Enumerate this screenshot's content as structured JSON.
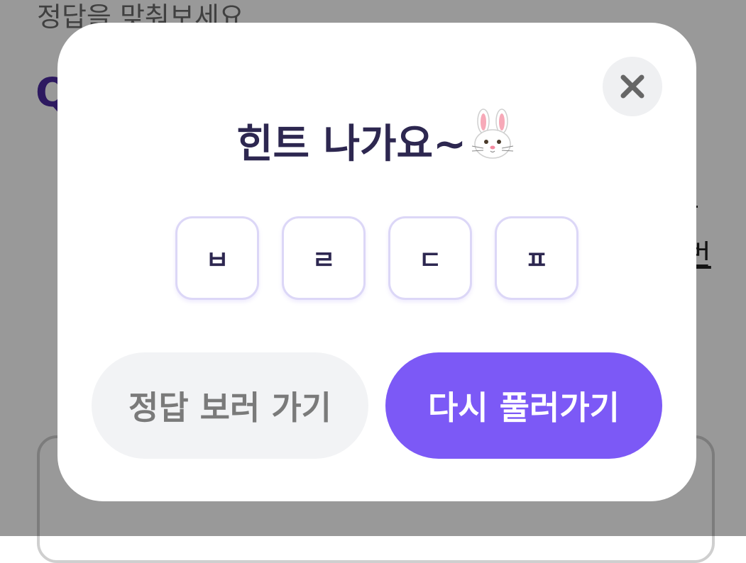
{
  "background": {
    "instruction": "정답을 맞춰보세요",
    "question_prefix": "Q",
    "right_text": "번"
  },
  "modal": {
    "title": "힌트 나가요~",
    "title_emoji": "rabbit-face",
    "close_icon": "close-icon",
    "hints": [
      "ㅂ",
      "ㄹ",
      "ㄷ",
      "ㅍ"
    ],
    "secondary_button": "정답 보러 가기",
    "primary_button": "다시 풀러가기"
  },
  "colors": {
    "accent": "#7c59f6",
    "title": "#2d2750",
    "secondary_bg": "#f2f3f5",
    "secondary_text": "#7a7a7a",
    "tile_border": "#dcd7f7",
    "overlay": "rgba(0,0,0,0.4)"
  }
}
